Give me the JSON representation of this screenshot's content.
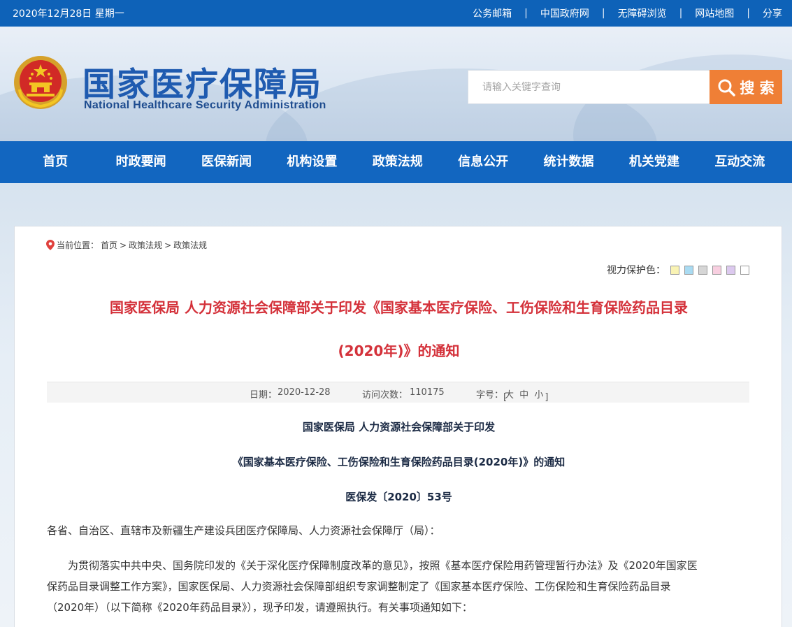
{
  "topbar": {
    "date": "2020年12月28日 星期一",
    "links": [
      "公务邮箱",
      "中国政府网",
      "无障碍浏览",
      "网站地图",
      "分享"
    ],
    "separator": "|"
  },
  "header": {
    "title_cn": "国家医疗保障局",
    "title_en": "National Healthcare Security Administration",
    "emblem_icon": "national-emblem-icon",
    "search": {
      "placeholder": "请输入关键字查询",
      "button_label": "搜 索"
    }
  },
  "nav": {
    "items": [
      "首页",
      "时政要闻",
      "医保新闻",
      "机构设置",
      "政策法规",
      "信息公开",
      "统计数据",
      "机关党建",
      "互动交流"
    ]
  },
  "breadcrumb": {
    "label": "当前位置：",
    "items": [
      "首页",
      "政策法规",
      "政策法规"
    ],
    "separator": ">"
  },
  "eye_protect": {
    "label": "视力保护色：",
    "colors": [
      "#f9f3b4",
      "#a9dbf2",
      "#d6d6d6",
      "#f8cfe0",
      "#dcc9ef",
      "#ffffff"
    ]
  },
  "article": {
    "title_line1": "国家医保局 人力资源社会保障部关于印发《国家基本医疗保险、工伤保险和生育保险药品目录",
    "title_line2": "(2020年)》的通知",
    "meta": {
      "date_label": "日期：",
      "date": "2020-12-28",
      "views_label": "访问次数：",
      "views": "110175",
      "font_label": "字号：",
      "font_open": "[",
      "font_close": "]",
      "font_sizes": [
        "大",
        "中",
        "小"
      ]
    },
    "subhead1": "国家医保局  人力资源社会保障部关于印发",
    "subhead2": "《国家基本医疗保险、工伤保险和生育保险药品目录(2020年)》的通知",
    "doc_no": "医保发〔2020〕53号",
    "salutation": "各省、自治区、直辖市及新疆生产建设兵团医疗保障局、人力资源社会保障厅（局）：",
    "body_line1": "为贯彻落实中共中央、国务院印发的《关于深化医疗保障制度改革的意见》，按照《基本医疗保险用药管理暂行办法》及《2020年国家医",
    "body_line2": "保药品目录调整工作方案》，国家医保局、人力资源社会保障部组织专家调整制定了《国家基本医疗保险、工伤保险和生育保险药品目录",
    "body_line3": "（2020年）（以下简称《2020年药品目录》），现予印发，请遵照执行。有关事项通知如下："
  }
}
